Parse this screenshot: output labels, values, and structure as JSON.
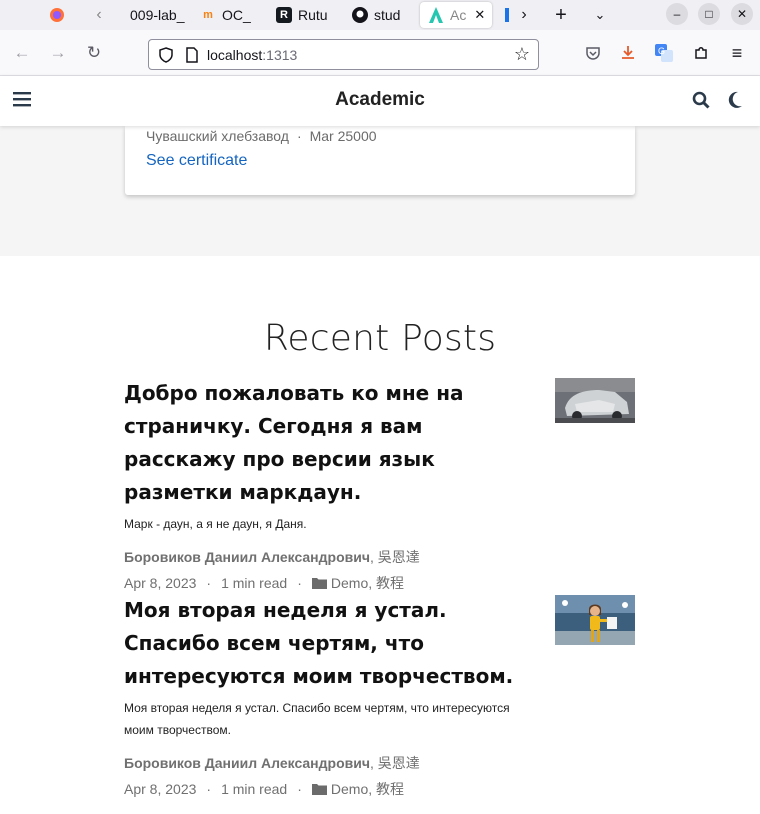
{
  "browser": {
    "tabs": [
      {
        "label": "009-lab_",
        "icon": "flask-icon"
      },
      {
        "label": "OC_",
        "icon": "moodle-icon"
      },
      {
        "label": "Rutu",
        "icon": "rutube-icon"
      },
      {
        "label": "stud",
        "icon": "github-icon"
      },
      {
        "label": "Ac",
        "icon": "academic-icon",
        "active": true
      }
    ],
    "url_host": "localhost",
    "url_port": ":1313"
  },
  "site": {
    "title": "Academic"
  },
  "certificate": {
    "org": "Чувашский хлебзавод",
    "date": "Mar 25000",
    "link": "See certificate"
  },
  "recent_posts": {
    "heading": "Recent Posts",
    "posts": [
      {
        "title": "Добро пожаловать ко мне на страничку. Сегодня я вам расскажу про версии язык разметки маркдаун.",
        "summary": "Марк - даун, а я не даун, я Даня.",
        "author_main": "Боровиков Даниил Александрович",
        "author_extra": ", 吳恩達",
        "date": "Apr 8, 2023",
        "read_time": "1 min read",
        "categories": "Demo, 教程"
      },
      {
        "title": "Моя вторая неделя я устал. Спасибо всем чертям, что интересуются моим творчеством.",
        "summary": "Моя вторая неделя я устал. Спасибо всем чертям, что интересуются моим творчеством.",
        "author_main": "Боровиков Даниил Александрович",
        "author_extra": ", 吳恩達",
        "date": "Apr 8, 2023",
        "read_time": "1 min read",
        "categories": "Demo, 教程"
      }
    ]
  },
  "colors": {
    "accent_link": "#1565c0",
    "download_icon": "#e55a2b"
  }
}
